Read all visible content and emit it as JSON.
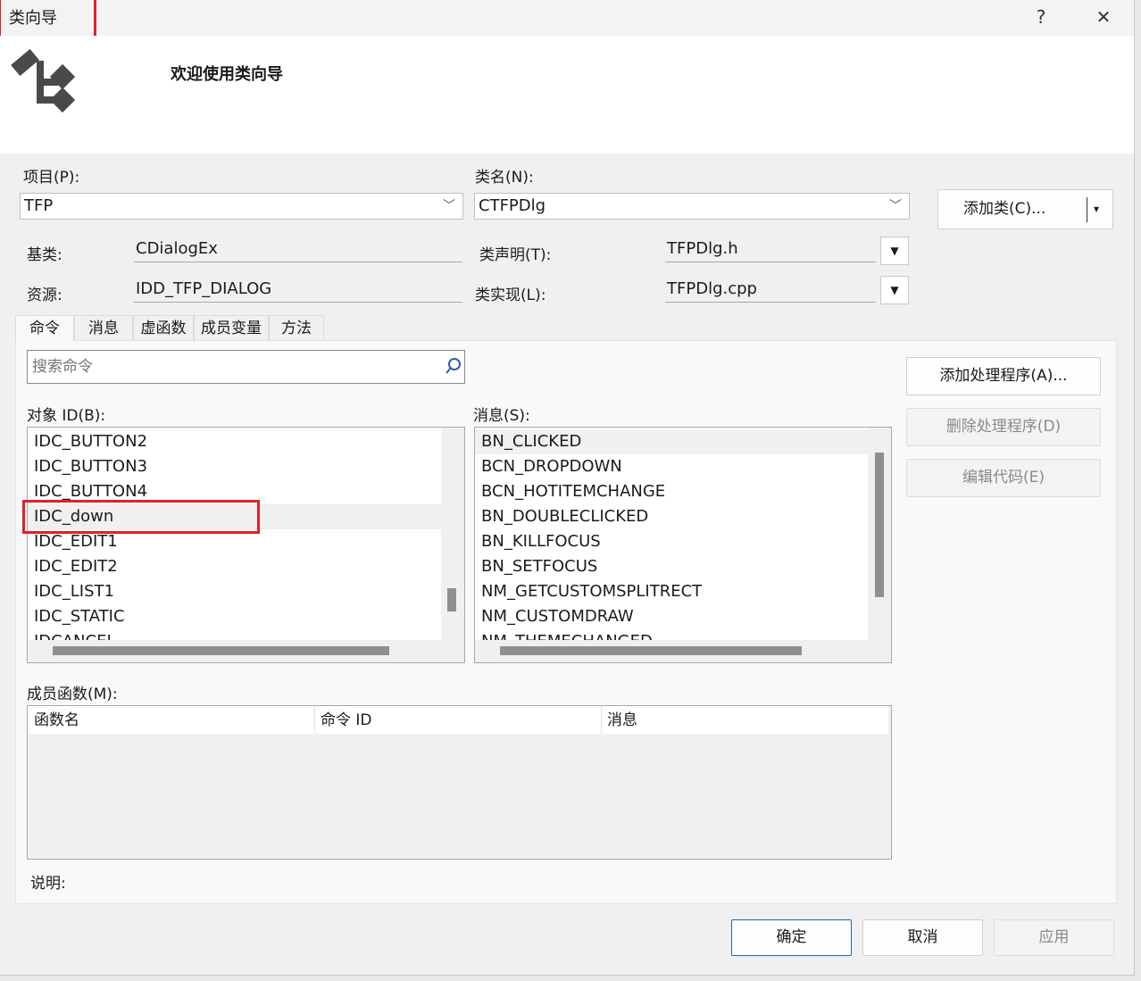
{
  "window": {
    "title": "类向导",
    "help": "?",
    "close": "✕"
  },
  "header": {
    "welcome": "欢迎使用类向导"
  },
  "project": {
    "label": "项目(P):",
    "value": "TFP"
  },
  "classname": {
    "label": "类名(N):",
    "value": "CTFPDlg"
  },
  "add_class": {
    "label": "添加类(C)...",
    "arrow": "▾"
  },
  "base_class": {
    "label": "基类:",
    "value": "CDialogEx"
  },
  "resource": {
    "label": "资源:",
    "value": "IDD_TFP_DIALOG"
  },
  "class_decl": {
    "label": "类声明(T):",
    "value": "TFPDlg.h"
  },
  "class_impl": {
    "label": "类实现(L):",
    "value": "TFPDlg.cpp"
  },
  "tabs": [
    {
      "label": "命令"
    },
    {
      "label": "消息"
    },
    {
      "label": "虚函数"
    },
    {
      "label": "成员变量"
    },
    {
      "label": "方法"
    }
  ],
  "search": {
    "placeholder": "搜索命令"
  },
  "object_ids": {
    "label": "对象 ID(B):",
    "items": [
      "IDC_BUTTON2",
      "IDC_BUTTON3",
      "IDC_BUTTON4",
      "IDC_down",
      "IDC_EDIT1",
      "IDC_EDIT2",
      "IDC_LIST1",
      "IDC_STATIC",
      "IDCANCEL"
    ],
    "selected": "IDC_down"
  },
  "messages": {
    "label": "消息(S):",
    "items": [
      "BN_CLICKED",
      "BCN_DROPDOWN",
      "BCN_HOTITEMCHANGE",
      "BN_DOUBLECLICKED",
      "BN_KILLFOCUS",
      "BN_SETFOCUS",
      "NM_GETCUSTOMSPLITRECT",
      "NM_CUSTOMDRAW",
      "NM_THEMECHANGED"
    ],
    "selected": "BN_CLICKED"
  },
  "handler_buttons": {
    "add": "添加处理程序(A)...",
    "delete": "删除处理程序(D)",
    "edit": "编辑代码(E)"
  },
  "member_functions": {
    "label": "成员函数(M):",
    "columns": [
      "函数名",
      "命令 ID",
      "消息"
    ]
  },
  "description": {
    "label": "说明:"
  },
  "footer": {
    "ok": "确定",
    "cancel": "取消",
    "apply": "应用"
  },
  "colors": {
    "highlight_box": "#e0202a",
    "ok_border": "#2b5fa8"
  }
}
